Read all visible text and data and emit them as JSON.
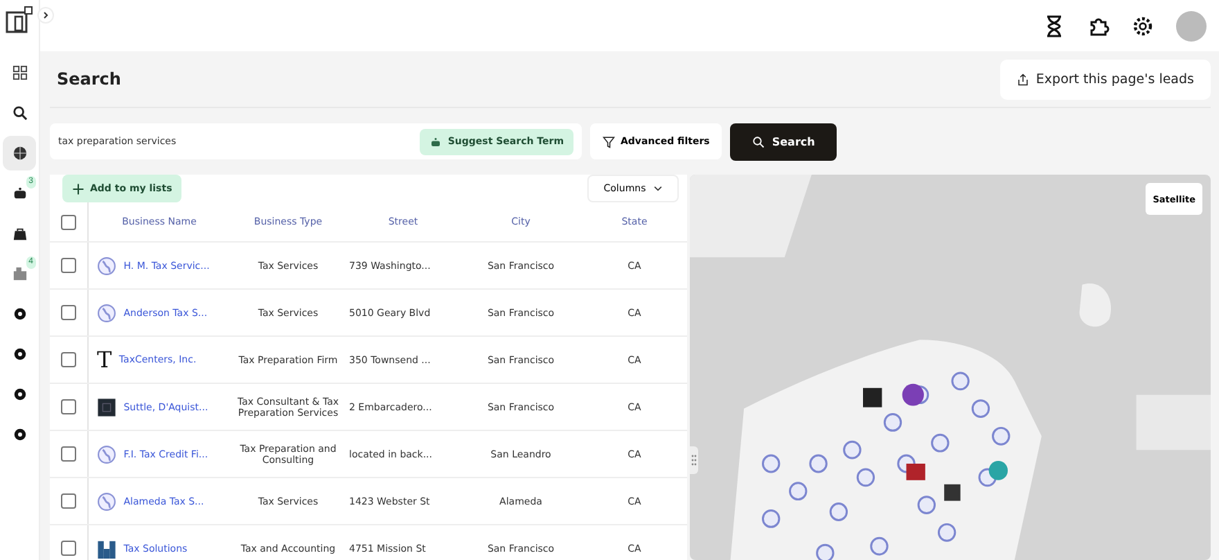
{
  "sidebar": {
    "items": [
      {
        "kind": "grid",
        "selected": false
      },
      {
        "kind": "search",
        "selected": false
      },
      {
        "kind": "globe",
        "selected": true
      },
      {
        "kind": "robot",
        "selected": false,
        "badge": "3"
      },
      {
        "kind": "bag",
        "selected": false
      },
      {
        "kind": "building",
        "selected": false,
        "badge": "4"
      },
      {
        "kind": "dot",
        "selected": false
      },
      {
        "kind": "dot",
        "selected": false
      },
      {
        "kind": "dot",
        "selected": false
      },
      {
        "kind": "dot",
        "selected": false
      }
    ]
  },
  "header": {
    "title": "Search",
    "export_button": "Export this page's leads"
  },
  "search": {
    "value": "tax preparation services",
    "suggest_button": "Suggest Search Term",
    "filters_button": "Advanced filters",
    "search_button": "Search"
  },
  "table": {
    "add_button": "Add to my lists",
    "columns_button": "Columns",
    "select_all": false,
    "columns": [
      "Business Name",
      "Business Type",
      "Street",
      "City",
      "State"
    ],
    "rows": [
      {
        "checked": false,
        "logo": {
          "kind": "globe"
        },
        "name": "H. M. Tax Servic...",
        "type": "Tax Services",
        "street": "739 Washingto...",
        "city": "San Francisco",
        "state": "CA"
      },
      {
        "checked": false,
        "logo": {
          "kind": "globe"
        },
        "name": "Anderson Tax S...",
        "type": "Tax Services",
        "street": "5010 Geary Blvd",
        "city": "San Francisco",
        "state": "CA"
      },
      {
        "checked": false,
        "logo": {
          "kind": "letter",
          "text": "T"
        },
        "name": "TaxCenters, Inc.",
        "type": "Tax Preparation Firm",
        "street": "350 Townsend ...",
        "city": "San Francisco",
        "state": "CA"
      },
      {
        "checked": false,
        "logo": {
          "kind": "square"
        },
        "name": "Suttle, D'Aquist...",
        "type": "Tax Consultant & Tax Preparation Services",
        "street": "2 Embarcadero...",
        "city": "San Francisco",
        "state": "CA"
      },
      {
        "checked": false,
        "logo": {
          "kind": "globe"
        },
        "name": "F.I. Tax Credit Fi...",
        "type": "Tax Preparation and Consulting",
        "street": "located in back...",
        "city": "San Leandro",
        "state": "CA"
      },
      {
        "checked": false,
        "logo": {
          "kind": "globe"
        },
        "name": "Alameda Tax S...",
        "type": "Tax Services",
        "street": "1423 Webster St",
        "city": "Alameda",
        "state": "CA"
      },
      {
        "checked": false,
        "logo": {
          "kind": "bars"
        },
        "name": "Tax Solutions",
        "type": "Tax and Accounting",
        "street": "4751 Mission St",
        "city": "San Francisco",
        "state": "CA"
      }
    ]
  },
  "map": {
    "satellite_button": "Satellite"
  }
}
